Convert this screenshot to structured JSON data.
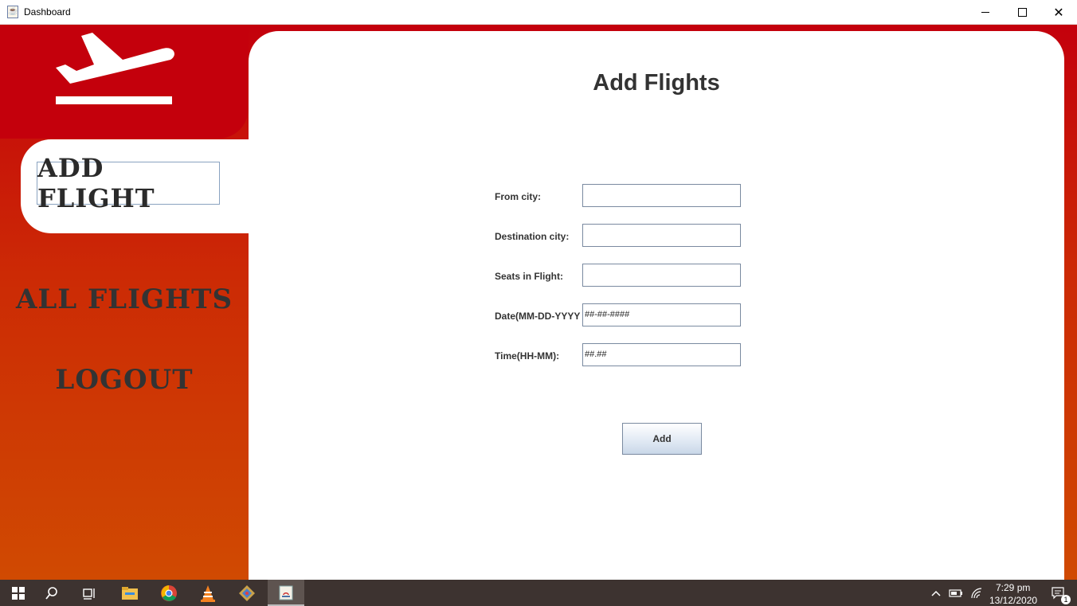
{
  "window": {
    "title": "Dashboard"
  },
  "sidebar": {
    "items": [
      {
        "label": "ADD FLIGHT",
        "active": true
      },
      {
        "label": "ALL FLIGHTS",
        "active": false
      },
      {
        "label": "LOGOUT",
        "active": false
      }
    ]
  },
  "main": {
    "heading": "Add Flights",
    "form": {
      "from_city": {
        "label": "From city:",
        "value": ""
      },
      "destination_city": {
        "label": "Destination city:",
        "value": ""
      },
      "seats": {
        "label": "Seats in Flight:",
        "value": ""
      },
      "date": {
        "label": "Date(MM-DD-YYYY",
        "value": "##-##-####"
      },
      "time": {
        "label": "Time(HH-MM):",
        "value": "##.##"
      }
    },
    "add_button": "Add"
  },
  "taskbar": {
    "time": "7:29 pm",
    "date": "13/12/2020",
    "notification_count": "1"
  },
  "colors": {
    "sidebar_top": "#c4000c",
    "sidebar_bottom": "#d04a02",
    "text_dark": "#333333"
  }
}
